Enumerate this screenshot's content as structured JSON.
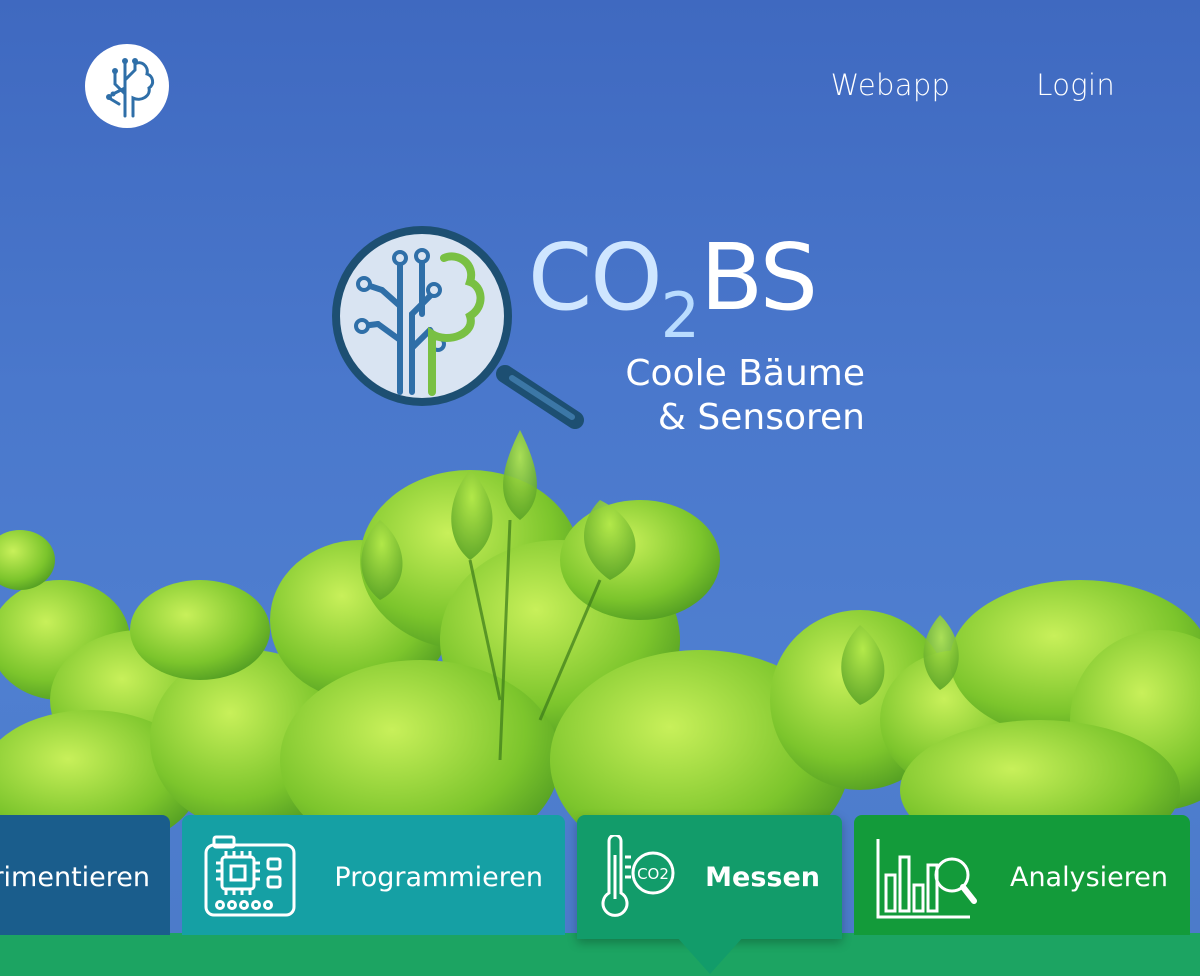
{
  "header": {
    "nav": {
      "webapp": "Webapp",
      "login": "Login"
    }
  },
  "hero": {
    "brand_co": "CO",
    "brand_sub": "2",
    "brand_bs": "BS",
    "tagline_line1": "Coole Bäume",
    "tagline_line2": "&  Sensoren"
  },
  "tiles": {
    "experimentieren": "Experimentieren",
    "experimentieren_visible": "rimentieren",
    "programmieren": "Programmieren",
    "messen": "Messen",
    "analysieren": "Analysieren",
    "co2_badge": "CO2"
  },
  "colors": {
    "sky": "#4a73c2",
    "tile_experimentieren": "#1a5d8c",
    "tile_programmieren": "#15a0a4",
    "tile_messen": "#129c6a",
    "tile_analysieren": "#139b3a",
    "bottom_bar": "#1ca462"
  },
  "icons": {
    "header_logo": "tree-circuit-icon",
    "hero_logo": "magnifier-tree-icon",
    "programmieren": "circuit-board-icon",
    "messen": "thermometer-co2-icon",
    "analysieren": "chart-magnifier-icon"
  }
}
